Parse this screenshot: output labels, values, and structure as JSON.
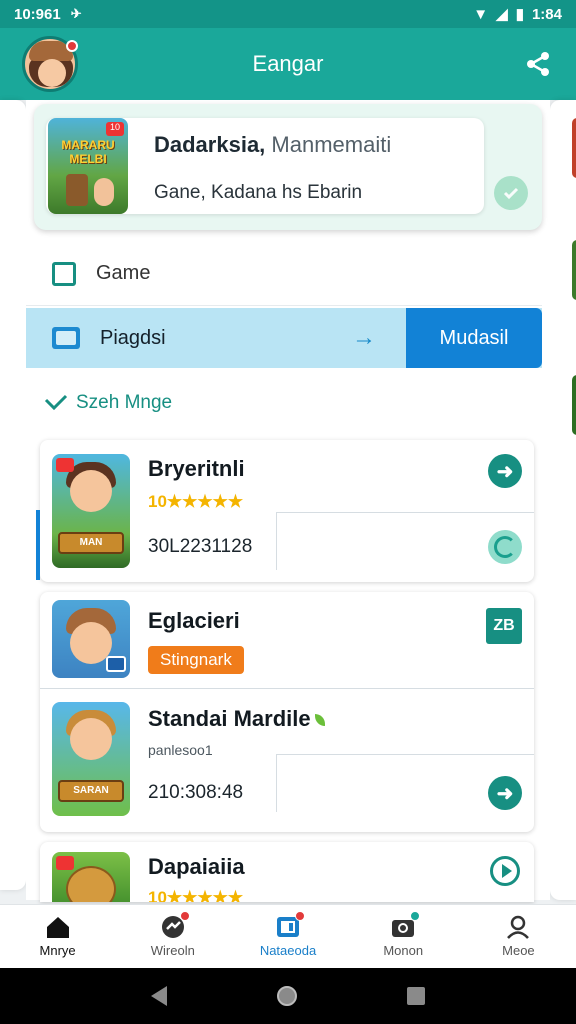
{
  "status_bar": {
    "time": "10:961",
    "right_time": "1:84"
  },
  "app_bar": {
    "title": "Eangar",
    "share_icon": "share-icon"
  },
  "hero": {
    "title_bold": "Dadarksia,",
    "title_light": "Manmemaiti",
    "subtitle": "Gane, Kadana hs Ebarin",
    "thumb_text": "MARARU MELBI",
    "thumb_badge": "10"
  },
  "menu": {
    "game_label": "Game",
    "play_label": "Piagdsi",
    "play_button": "Mudasil"
  },
  "section": {
    "title": "Szeh Mnge"
  },
  "items": [
    {
      "title": "Bryeritnli",
      "stars_num": "10",
      "stars": "★★★★★",
      "number": "30L2231128",
      "thumb_text": "MAN"
    },
    {
      "title": "Eglacieri",
      "badge": "Stingnark",
      "badge_icon_text": "ZB"
    },
    {
      "title": "Standai Mardile",
      "subtitle": "panlesoo1",
      "number": "210:308:48",
      "thumb_text": "SARAN"
    },
    {
      "title": "Dapaiaiia",
      "stars_num": "10",
      "stars": "★★★★★"
    }
  ],
  "bottom_nav": [
    {
      "label": "Mnrye",
      "icon": "home-icon"
    },
    {
      "label": "Wireoln",
      "icon": "chat-icon"
    },
    {
      "label": "Nataeoda",
      "icon": "calendar-icon"
    },
    {
      "label": "Monon",
      "icon": "camera-icon"
    },
    {
      "label": "Meoe",
      "icon": "profile-icon"
    }
  ],
  "colors": {
    "teal": "#1aa89a",
    "blue": "#1282d6",
    "orange": "#f07c1a",
    "star": "#f4b400"
  }
}
